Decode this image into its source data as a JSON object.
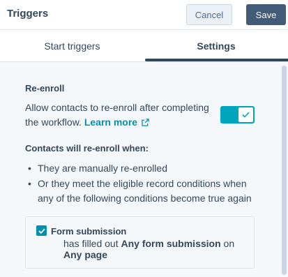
{
  "header": {
    "title": "Triggers",
    "cancel_label": "Cancel",
    "save_label": "Save"
  },
  "tabs": [
    {
      "label": "Start triggers",
      "active": false
    },
    {
      "label": "Settings",
      "active": true
    }
  ],
  "reenroll": {
    "title": "Re-enroll",
    "description": "Allow contacts to re-enroll after completing the workflow.",
    "learn_more": "Learn more",
    "toggle_on": true,
    "conditions_title": "Contacts will re-enroll when:",
    "bullets": [
      "They are manually re-enrolled",
      "Or they meet the eligible record conditions when any of the following conditions become true again"
    ]
  },
  "condition_card": {
    "checked": true,
    "title": "Form submission",
    "prefix": "has filled out",
    "form": "Any form submission",
    "connector": "on",
    "page": "Any page"
  },
  "colors": {
    "primary_dark": "#425b76",
    "accent_teal": "#00a4bd",
    "link": "#0091ae",
    "text": "#33475b",
    "background": "#f5f8fa"
  }
}
